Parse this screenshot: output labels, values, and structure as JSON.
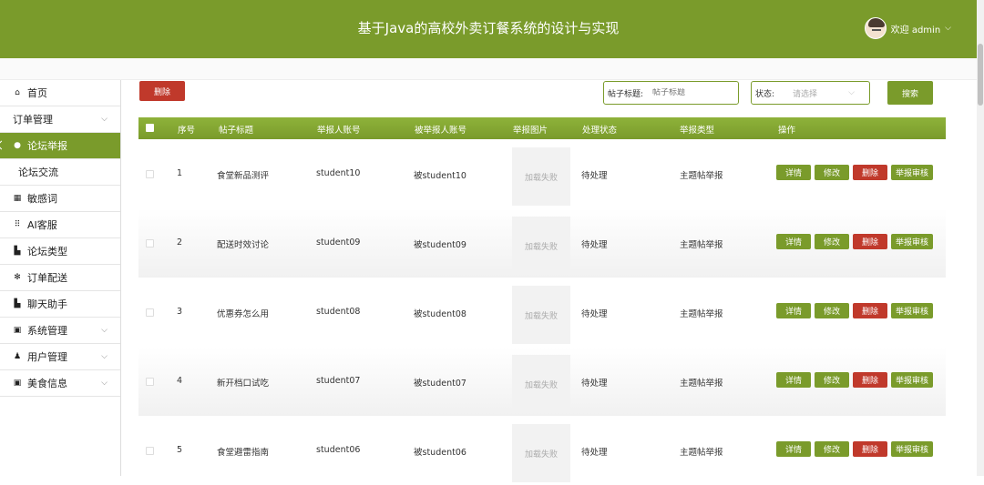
{
  "header": {
    "title": "基于Java的高校外卖订餐系统的设计与实现",
    "welcome": "欢迎 admin"
  },
  "sidebar": {
    "items": [
      {
        "label": "首页",
        "icon": "home-icon",
        "glyph": "⌂"
      },
      {
        "label": "订单管理",
        "icon": "",
        "glyph": "",
        "chevron": true
      },
      {
        "label": "论坛举报",
        "icon": "report-icon",
        "glyph": "●",
        "active": true
      },
      {
        "label": "论坛交流",
        "icon": "",
        "glyph": "",
        "sub": true
      },
      {
        "label": "敏感词",
        "icon": "grid-icon",
        "glyph": "▦"
      },
      {
        "label": "AI客服",
        "icon": "apps-icon",
        "glyph": "⠿"
      },
      {
        "label": "论坛类型",
        "icon": "document-icon",
        "glyph": "▙"
      },
      {
        "label": "订单配送",
        "icon": "settings-icon",
        "glyph": "✻"
      },
      {
        "label": "聊天助手",
        "icon": "chat-icon",
        "glyph": "▙"
      },
      {
        "label": "系统管理",
        "icon": "system-icon",
        "glyph": "▣",
        "chevron": true
      },
      {
        "label": "用户管理",
        "icon": "user-icon",
        "glyph": "♟",
        "chevron": true
      },
      {
        "label": "美食信息",
        "icon": "food-icon",
        "glyph": "▣",
        "chevron": true
      }
    ]
  },
  "toolbar": {
    "delete_label": "删除",
    "title_label": "帖子标题:",
    "title_placeholder": "帖子标题",
    "status_label": "状态:",
    "status_placeholder": "请选择",
    "search_label": "搜索"
  },
  "table": {
    "headers": [
      "序号",
      "帖子标题",
      "举报人账号",
      "被举报人账号",
      "举报图片",
      "处理状态",
      "举报类型",
      "操作"
    ],
    "rows": [
      {
        "no": "1",
        "title": "食堂新品测评",
        "reporter": "student10",
        "reported": "被student10",
        "image": "加载失败",
        "status": "待处理",
        "type": "主题帖举报"
      },
      {
        "no": "2",
        "title": "配送时效讨论",
        "reporter": "student09",
        "reported": "被student09",
        "image": "加载失败",
        "status": "待处理",
        "type": "主题帖举报"
      },
      {
        "no": "3",
        "title": "优惠券怎么用",
        "reporter": "student08",
        "reported": "被student08",
        "image": "加载失败",
        "status": "待处理",
        "type": "主题帖举报"
      },
      {
        "no": "4",
        "title": "新开档口试吃",
        "reporter": "student07",
        "reported": "被student07",
        "image": "加载失败",
        "status": "待处理",
        "type": "主题帖举报"
      },
      {
        "no": "5",
        "title": "食堂避雷指南",
        "reporter": "student06",
        "reported": "被student06",
        "image": "加载失败",
        "status": "待处理",
        "type": "主题帖举报"
      }
    ],
    "actions": {
      "detail": "详情",
      "edit": "修改",
      "delete": "删除",
      "review": "举报审核"
    }
  },
  "colors": {
    "primary": "#7a9b2b",
    "danger": "#c0392b"
  }
}
